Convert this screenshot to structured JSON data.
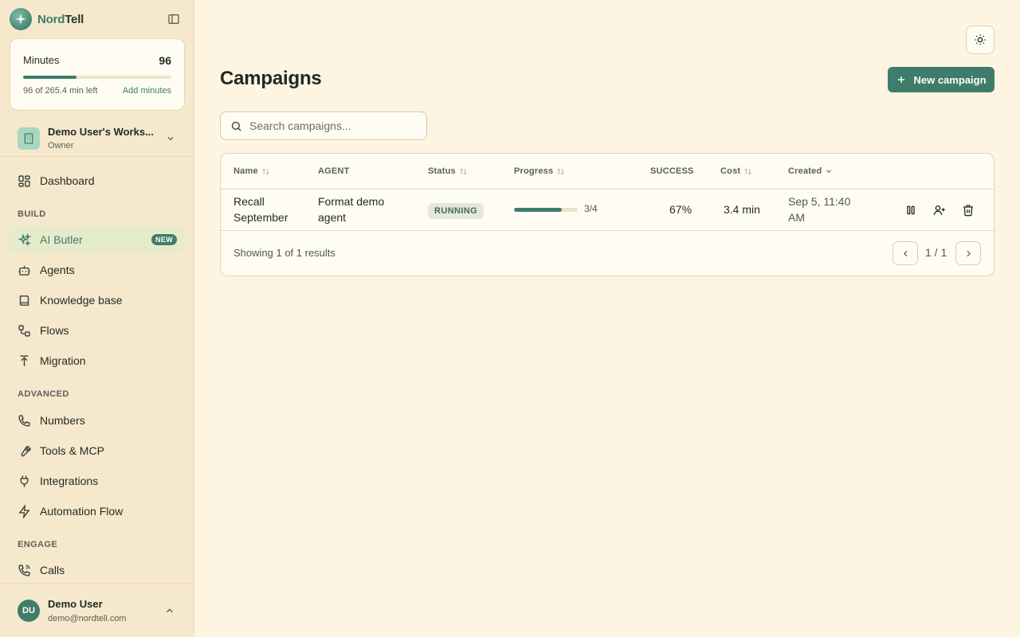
{
  "brand": {
    "name_part1": "Nord",
    "name_part2": "Tell"
  },
  "minutes": {
    "title": "Minutes",
    "count": "96",
    "remaining_text": "96 of 265.4 min left",
    "add_label": "Add minutes",
    "used_fraction": 0.362
  },
  "workspace": {
    "name": "Demo User's Works...",
    "role": "Owner"
  },
  "nav": {
    "dashboard": "Dashboard",
    "build_label": "BUILD",
    "ai_butler": "AI Butler",
    "ai_butler_badge": "NEW",
    "agents": "Agents",
    "knowledge_base": "Knowledge base",
    "flows": "Flows",
    "migration": "Migration",
    "advanced_label": "ADVANCED",
    "numbers": "Numbers",
    "tools_mcp": "Tools & MCP",
    "integrations": "Integrations",
    "automation_flow": "Automation Flow",
    "engage_label": "ENGAGE",
    "calls": "Calls"
  },
  "user": {
    "initials": "DU",
    "name": "Demo User",
    "email": "demo@nordtell.com"
  },
  "page": {
    "title": "Campaigns",
    "new_button": "New campaign"
  },
  "search": {
    "placeholder": "Search campaigns...",
    "value": ""
  },
  "table": {
    "headers": {
      "name": "Name",
      "agent": "AGENT",
      "status": "Status",
      "progress": "Progress",
      "success": "SUCCESS",
      "cost": "Cost",
      "created": "Created"
    },
    "rows": [
      {
        "name_line1": "Recall",
        "name_line2": "September",
        "agent_line1": "Format demo",
        "agent_line2": "agent",
        "status": "RUNNING",
        "progress_text": "3/4",
        "progress_fraction": 0.75,
        "success": "67%",
        "cost": "3.4 min",
        "created_line1": "Sep 5, 11:40",
        "created_line2": "AM"
      }
    ],
    "showing": "Showing 1 of 1 results",
    "pagination": "1 / 1"
  },
  "colors": {
    "accent": "#3e7d69",
    "sidebar_bg": "#f6e8cc",
    "page_bg": "#fdf4e2"
  },
  "icons": [
    "sparkle-logo-icon",
    "sidebar-toggle-icon",
    "building-icon",
    "chevron-down-icon",
    "layout-grid-icon",
    "sparkles-icon",
    "bot-icon",
    "book-icon",
    "workflow-icon",
    "upload-icon",
    "phone-icon",
    "wrench-icon",
    "plug-icon",
    "zap-icon",
    "phone-call-icon",
    "chevron-up-icon",
    "sun-icon",
    "plus-icon",
    "search-icon",
    "sort-icon",
    "pause-icon",
    "user-plus-icon",
    "trash-icon",
    "chevron-left-icon",
    "chevron-right-icon"
  ]
}
